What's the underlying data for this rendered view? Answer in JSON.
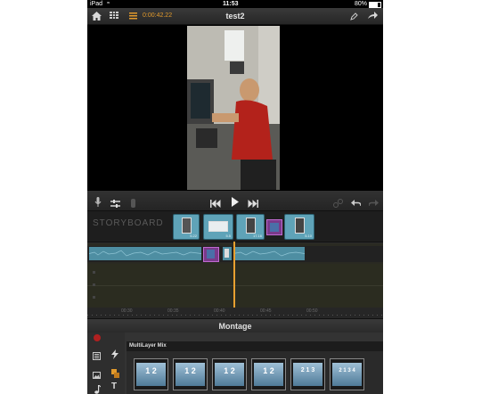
{
  "status_bar": {
    "device": "iPad",
    "time": "11:53",
    "battery": "80%"
  },
  "toolbar": {
    "timecode": "0:00:42.22",
    "title": "test2",
    "icons": [
      "home-icon",
      "grid-icon",
      "list-icon",
      "edit-icon",
      "share-icon"
    ]
  },
  "transport": {
    "icons": [
      "microphone-icon",
      "audio-levels-icon",
      "effect-icon",
      "skip-back-icon",
      "play-icon",
      "skip-forward-icon",
      "link-icon",
      "undo-icon",
      "redo-icon"
    ]
  },
  "storyboard": {
    "label": "STORYBOARD",
    "clips": [
      {
        "duration": "5.22"
      },
      {
        "duration": "5.5"
      },
      {
        "duration": "17.16"
      },
      {
        "duration": ""
      },
      {
        "duration": "5.10"
      }
    ]
  },
  "ruler": {
    "ticks": [
      "00:30",
      "00:35",
      "00:40",
      "00:45",
      "00:50"
    ]
  },
  "montage": {
    "title": "Montage",
    "section_label": "MultiLayer Mix",
    "templates": [
      {
        "label": "1 2"
      },
      {
        "label": "1 2"
      },
      {
        "label": "1 2"
      },
      {
        "label": "1 2"
      },
      {
        "label": "2 1 3"
      },
      {
        "label": "2 1 3 4"
      }
    ],
    "side_icons": [
      "record-icon",
      "film-icon",
      "lightning-icon",
      "image-icon",
      "layers-icon",
      "music-icon",
      "text-icon"
    ],
    "text_icon_glyph": "T"
  },
  "colors": {
    "accent": "#e29a2c",
    "clip_blue": "#5fa3b8",
    "playhead": "#e8a030",
    "background": "#2b2b2b"
  }
}
